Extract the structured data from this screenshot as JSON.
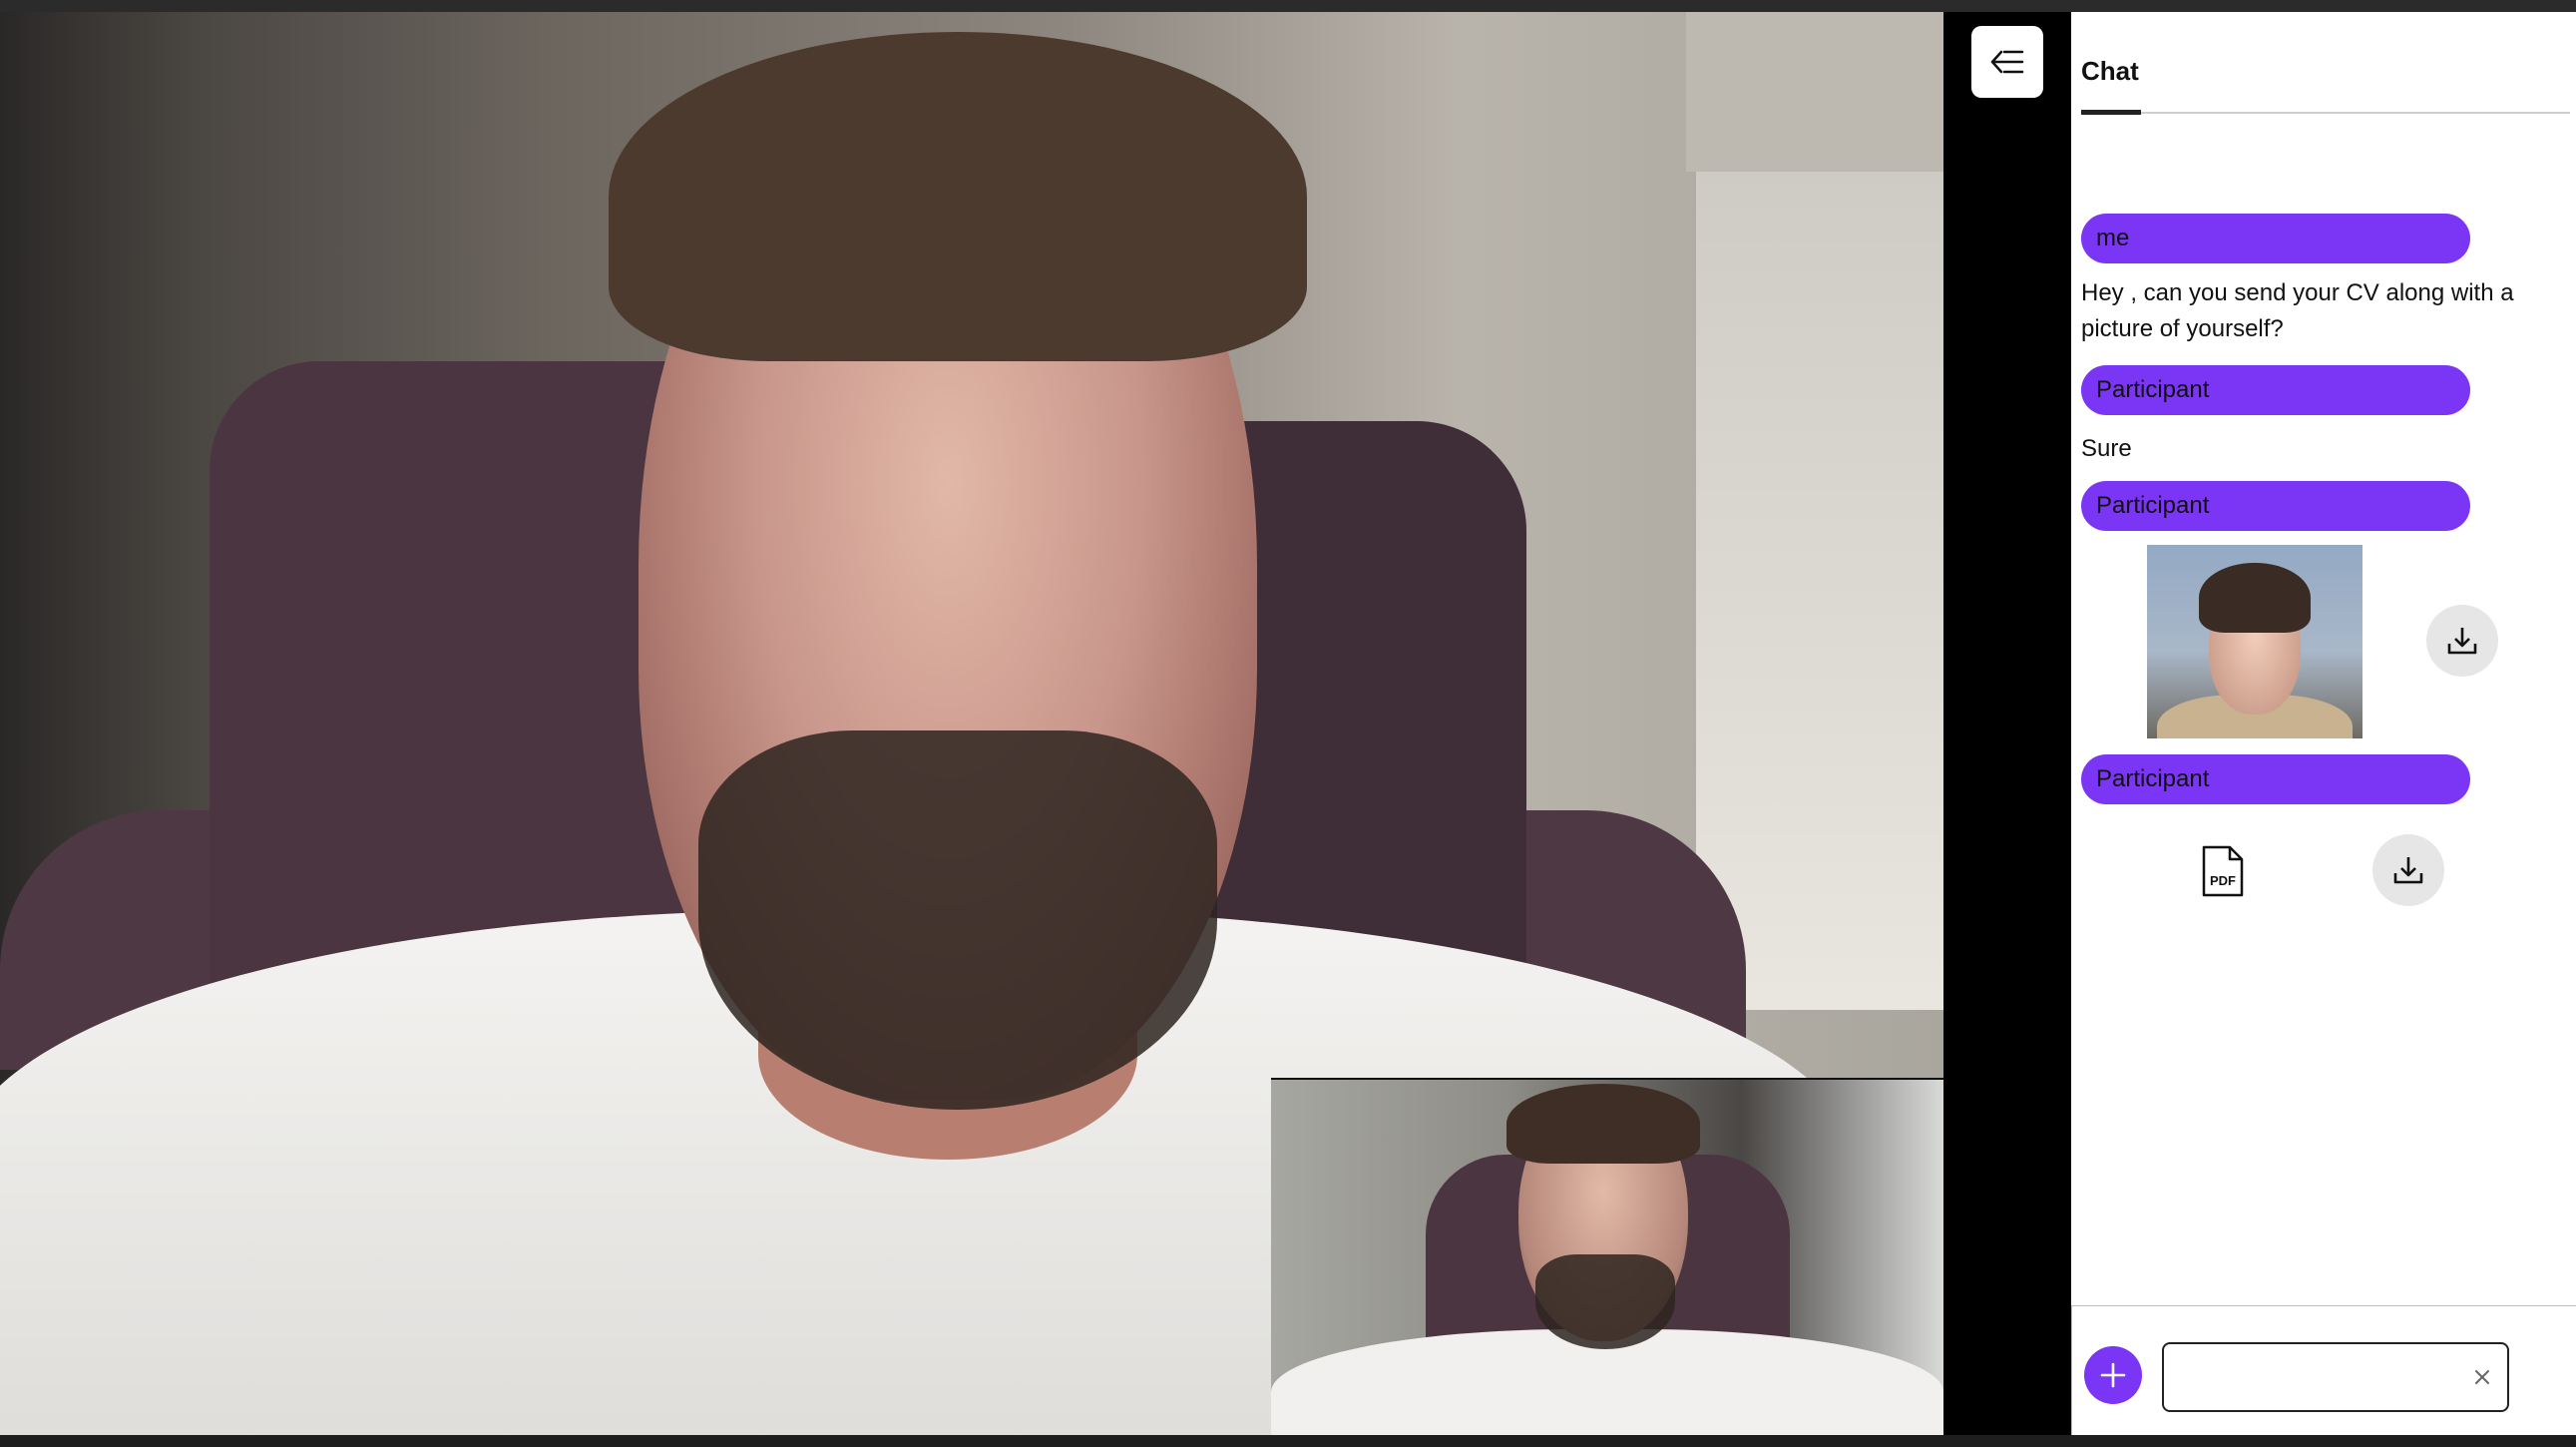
{
  "toolbar": {
    "toggle_icon": "collapse-panel-icon"
  },
  "chat": {
    "tab_label": "Chat",
    "messages": [
      {
        "sender": "me",
        "type": "text",
        "text": "Hey , can you send your CV along with a picture of yourself?"
      },
      {
        "sender": "Participant",
        "type": "text",
        "text": "Sure"
      },
      {
        "sender": "Participant",
        "type": "image",
        "icon": "download-icon"
      },
      {
        "sender": "Participant",
        "type": "file",
        "file_icon": "pdf-file-icon",
        "file_icon_label": "PDF",
        "icon": "download-icon"
      }
    ]
  },
  "composer": {
    "add_icon": "plus-icon",
    "input_value": "",
    "input_placeholder": "",
    "clear_icon": "close-icon"
  },
  "colors": {
    "accent": "#7b35f4",
    "panel_bg": "#ffffff",
    "gutter": "#000000"
  }
}
